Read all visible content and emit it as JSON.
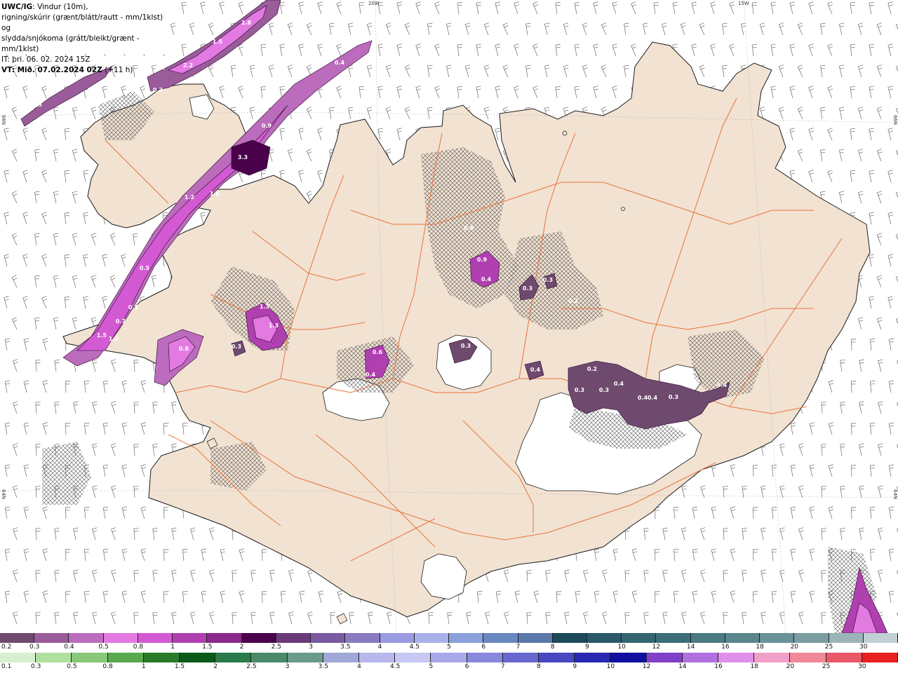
{
  "header": {
    "model_prefix": "UWC/IG",
    "title_line1": ": Vindur (10m),",
    "title_line2": "rigning/skúrir (grænt/blátt/rautt - mm/1klst) og",
    "title_line3": "slydda/snjókoma (grátt/bleikt/grænt - mm/1klst)",
    "init_time": "IT: þri. 06. 02. 2024 15Z",
    "valid_prefix": "VT: Mið. 07.02.2024 02Z",
    "valid_suffix": " (+11 h)"
  },
  "coordinates": {
    "lon_20w": "20W",
    "lon_15w": "15W",
    "lat_66n_left": "66N",
    "lat_66n_right": "66N",
    "lat_64n_left": "64N",
    "lat_64n_right": "64N"
  },
  "legend_snow": {
    "labels": [
      "0.2",
      "0.3",
      "0.4",
      "0.5",
      "0.8",
      "1",
      "1.5",
      "2",
      "2.5",
      "3",
      "3.5",
      "4",
      "4.5",
      "5",
      "6",
      "7",
      "8",
      "9",
      "10",
      "12",
      "14",
      "16",
      "18",
      "20",
      "25",
      "30"
    ],
    "colors": [
      "#6e4a6e",
      "#9a5c9a",
      "#bc6cbc",
      "#e27ae2",
      "#d45ad4",
      "#b040b0",
      "#8a2a8a",
      "#4a004a",
      "#6a3a7a",
      "#7a5aa0",
      "#8a7ac0",
      "#9a9ae0",
      "#aab0ea",
      "#8aa0d8",
      "#6a88c0",
      "#5a78a8",
      "#1c4a5a",
      "#2a5868",
      "#336670",
      "#3c6e78",
      "#4a7a82",
      "#5a868c",
      "#6a9298",
      "#7a9ea2",
      "#9ab4b8",
      "#c0d0d4"
    ]
  },
  "legend_rain": {
    "labels": [
      "0.1",
      "0.3",
      "0.5",
      "0.8",
      "1",
      "1.5",
      "2",
      "2.5",
      "3",
      "3.5",
      "4",
      "4.5",
      "5",
      "6",
      "7",
      "8",
      "9",
      "10",
      "12",
      "14",
      "16",
      "18",
      "20",
      "25",
      "30"
    ],
    "colors": [
      "#d8f0d0",
      "#b0e0a0",
      "#88c878",
      "#5aa850",
      "#2a7a2a",
      "#0a5a1a",
      "#2a7a4a",
      "#4a8a6a",
      "#6a9a8a",
      "#a0a8d8",
      "#b8b8ec",
      "#c8c8f4",
      "#a8a8e8",
      "#8888dc",
      "#6868d0",
      "#4848c0",
      "#2828b0",
      "#1010a0",
      "#8040c8",
      "#b070e0",
      "#e090e8",
      "#f0a0c8",
      "#f08898",
      "#e85868",
      "#e82020"
    ]
  },
  "cell_values": [
    "1.8",
    "1.5",
    "2.2",
    "0.3",
    "0.3",
    "0.4",
    "0.3",
    "0.9",
    "3.3",
    "1.6",
    "1.2",
    "0.5",
    "0.4",
    "0.7",
    "1.5",
    "1.2",
    "1.3",
    "0.8",
    "0.3",
    "1.3",
    "0.4",
    "0.6",
    "0.4",
    "0.3",
    "0.3",
    "0.9",
    "0.4",
    "0.3",
    "0.2",
    "0.2",
    "0.4",
    "0.4",
    "0.3",
    "0.3",
    "0.4",
    "0.4",
    "0.3",
    "0.4"
  ],
  "colors": {
    "land": "#f2e2d2",
    "road": "#e8743c",
    "coast": "#1a1a1a",
    "barb": "#6a6a6a"
  }
}
